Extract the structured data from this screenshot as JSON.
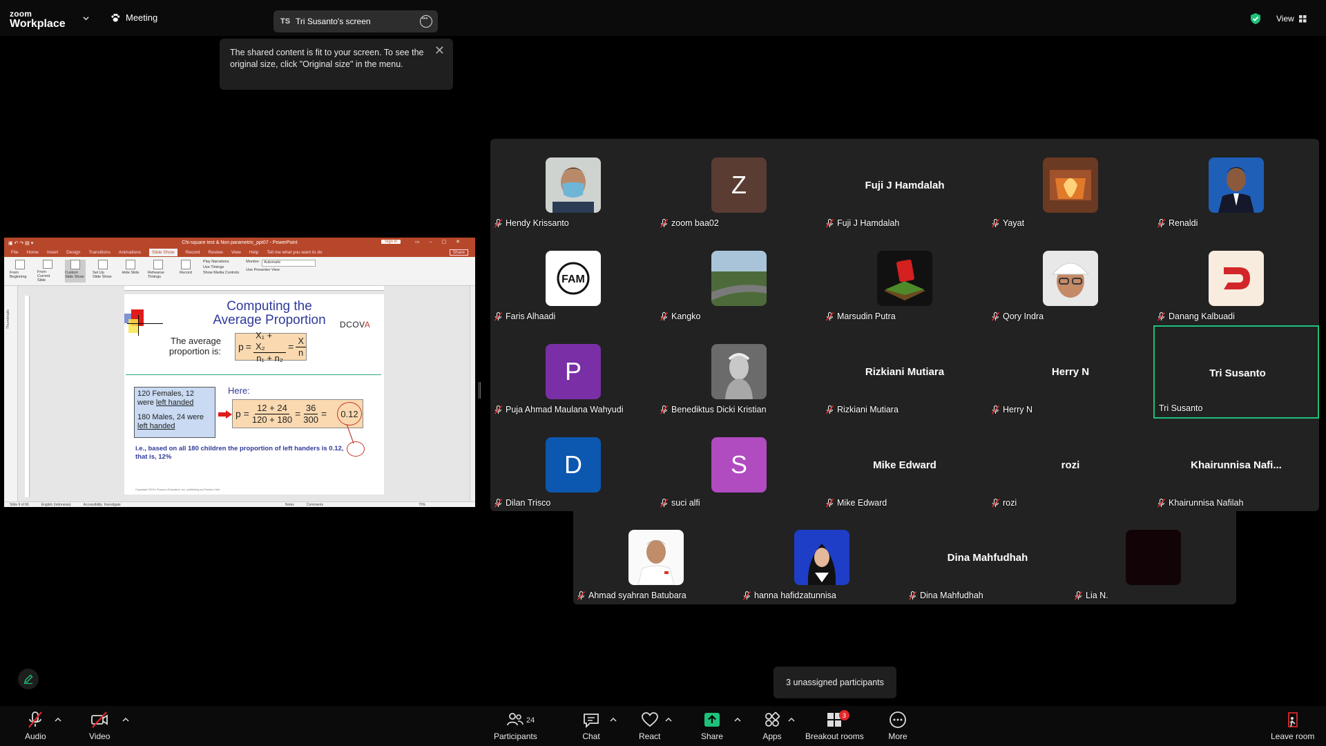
{
  "app": {
    "logo_line1": "zoom",
    "logo_line2": "Workplace",
    "meeting_label": "Meeting",
    "share_initials": "TS",
    "share_title": "Tri Susanto's screen",
    "view_label": "View"
  },
  "tooltip": {
    "text": "The shared content is fit to your screen. To see the original size, click \"Original size\" in the menu."
  },
  "ppt": {
    "window_title": "Chi-square test & Non parametric_ppt07  -  PowerPoint",
    "sign_in": "Sign in",
    "share_btn": "Share",
    "tabs": [
      "File",
      "Home",
      "Insert",
      "Design",
      "Transitions",
      "Animations",
      "Slide Show",
      "Record",
      "Review",
      "View",
      "Help",
      "Tell me what you want to do"
    ],
    "active_tab": "Slide Show",
    "ribbon_buttons": [
      "From Beginning",
      "From Current Slide",
      "Custom Slide Show",
      "Set Up Slide Show",
      "Hide Slide",
      "Rehearse Timings",
      "Record"
    ],
    "checkboxes": [
      "Play Narrations",
      "Use Timings",
      "Show Media Controls"
    ],
    "monitor_label": "Monitor:",
    "monitor_value": "Automatic",
    "presenter_view": "Use Presenter View",
    "group_labels": [
      "Start Slide Show",
      "Set Up",
      "Monitors"
    ],
    "custom_shows": "Custom Shows...",
    "thumbnails": "Thumbnails",
    "status": {
      "slide": "Slide 9 of 66",
      "language": "English (Indonesia)",
      "accessibility": "Accessibility: Investigate",
      "notes": "Notes",
      "comments": "Comments",
      "zoom": "70%"
    },
    "slide": {
      "title_line1": "Computing the",
      "title_line2": "Average Proportion",
      "dcova_prefix": "DCOV",
      "dcova_accent": "A",
      "avg_label": "The average proportion is:",
      "f1_p": "p",
      "f1_num": "X₁ + X₂",
      "f1_den": "n₁ + n₂",
      "f1_num2": "X",
      "f1_den2": "n",
      "box_line1": "120 Females, 12 were",
      "box_line1_u": "left handed",
      "box_line2": "180 Males, 24 were",
      "box_line2_u": "left handed",
      "here": "Here:",
      "f2_num": "12 + 24",
      "f2_den": "120 + 180",
      "f2_num2": "36",
      "f2_den2": "300",
      "f2_result": "0.12",
      "ie_text": "i.e., based on all 180 children the proportion of left handers is 0.12, that is, 12%",
      "copyright": "Copyright ©2011 Pearson Education, Inc. publishing as Prentice Hall"
    }
  },
  "participants_gallery": [
    {
      "name": "Hendy Krissanto",
      "avatar": "photo-mask"
    },
    {
      "name": "zoom baa02",
      "avatar": "letter",
      "letter": "Z"
    },
    {
      "name": "Fuji J Hamdalah",
      "avatar": "none",
      "display": "Fuji J Hamdalah"
    },
    {
      "name": "Yayat",
      "avatar": "photo-fire"
    },
    {
      "name": "Renaldi",
      "avatar": "photo-suit"
    },
    {
      "name": "Faris Alhaadi",
      "avatar": "logo-fam",
      "logo_text": "FAM"
    },
    {
      "name": "Kangko",
      "avatar": "photo-road"
    },
    {
      "name": "Marsudin Putra",
      "avatar": "photo-red"
    },
    {
      "name": "Qory Indra",
      "avatar": "photo-cap"
    },
    {
      "name": "Danang Kalbuadi",
      "avatar": "logo-d"
    },
    {
      "name": "Puja Ahmad Maulana Wahyudi",
      "avatar": "letter",
      "letter": "P"
    },
    {
      "name": "Benediktus Dicki Kristian",
      "avatar": "photo-statue"
    },
    {
      "name": "Rizkiani Mutiara",
      "avatar": "none",
      "display": "Rizkiani Mutiara"
    },
    {
      "name": "Herry N",
      "avatar": "none",
      "display": "Herry N"
    },
    {
      "name": "Tri Susanto",
      "avatar": "none",
      "display": "Tri Susanto",
      "active": true
    },
    {
      "name": "Dilan Trisco",
      "avatar": "letter",
      "letter": "D"
    },
    {
      "name": "suci alfi",
      "avatar": "letter",
      "letter": "S"
    },
    {
      "name": "Mike Edward",
      "avatar": "none",
      "display": "Mike Edward"
    },
    {
      "name": "rozi",
      "avatar": "none",
      "display": "rozi"
    },
    {
      "name": "Khairunnisa Nafilah",
      "avatar": "none",
      "display": "Khairunnisa  Nafi..."
    },
    {
      "name": "Ahmad syahran Batubara",
      "avatar": "photo-boy"
    },
    {
      "name": "hanna hafidzatunnisa",
      "avatar": "photo-hijab"
    },
    {
      "name": "Dina Mahfudhah",
      "avatar": "none",
      "display": "Dina Mahfudhah"
    },
    {
      "name": "Lia N.",
      "avatar": "dark"
    }
  ],
  "unassigned": "3 unassigned participants",
  "toolbar": {
    "audio": "Audio",
    "video": "Video",
    "participants": "Participants",
    "participants_count": "24",
    "chat": "Chat",
    "react": "React",
    "share": "Share",
    "apps": "Apps",
    "breakout": "Breakout rooms",
    "breakout_badge": "3",
    "more": "More",
    "leave": "Leave room"
  },
  "colors": {
    "accent_green": "#1dc27a",
    "mute_red": "#e02828",
    "share_green": "#1dc27a",
    "ppt_red": "#b7472a"
  }
}
